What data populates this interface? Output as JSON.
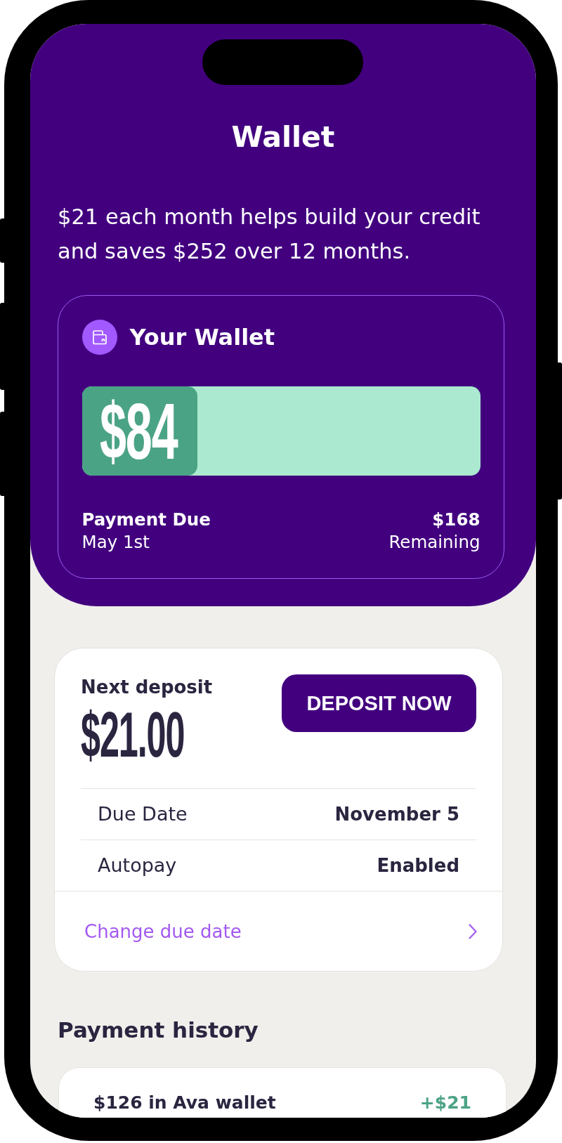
{
  "header": {
    "title": "Wallet",
    "subtitle": "$21 each month helps build your credit and saves $252 over 12 months."
  },
  "wallet_card": {
    "title": "Your Wallet",
    "balance": "$84",
    "level": 0.29,
    "due_label": "Payment Due",
    "due_date": "May 1st",
    "remaining_amount": "$168",
    "remaining_label": "Remaining"
  },
  "deposit_card": {
    "label": "Next deposit",
    "amount": "$21.00",
    "button": "DEPOSIT NOW",
    "details": [
      {
        "label": "Due Date",
        "value": "November 5"
      },
      {
        "label": "Autopay",
        "value": "Enabled"
      }
    ],
    "link": "Change due date"
  },
  "payment_history": {
    "title": "Payment history",
    "items": [
      {
        "description": "$126 in Ava wallet",
        "amount": "+$21"
      }
    ]
  }
}
